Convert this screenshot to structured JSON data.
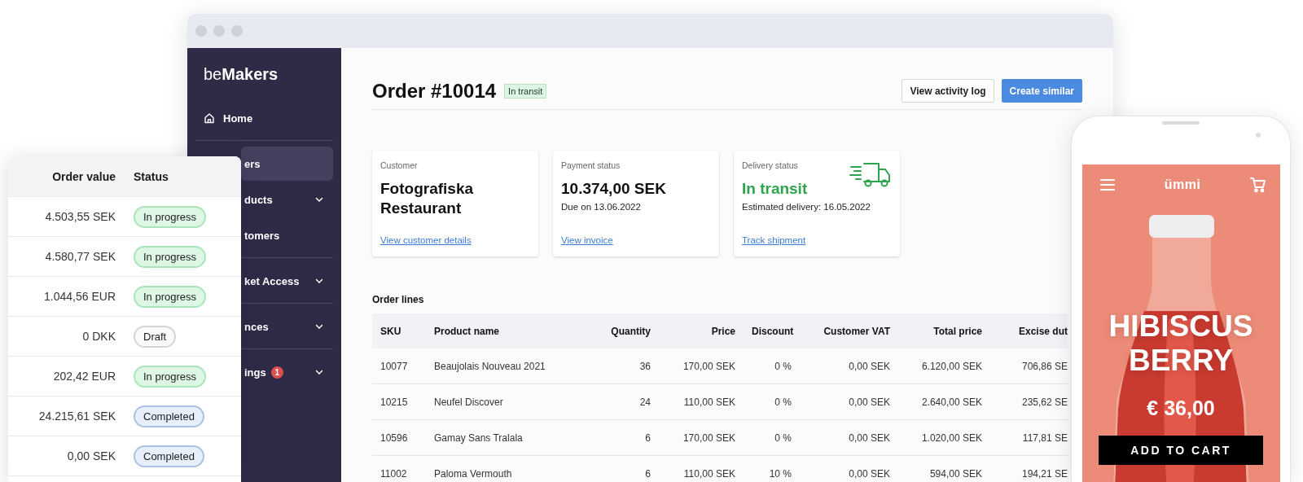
{
  "browser": {
    "sidebar": {
      "logo": "be**Makers**",
      "items": [
        {
          "label": "Home",
          "kind": "with_icon",
          "selected": false,
          "expandable": false,
          "divider": true
        },
        {
          "label": "ers",
          "kind": "plain",
          "selected": true,
          "expandable": false,
          "divider": false
        },
        {
          "label": "ducts",
          "kind": "plain",
          "selected": false,
          "expandable": true,
          "divider": false
        },
        {
          "label": "tomers",
          "kind": "plain",
          "selected": false,
          "expandable": false,
          "divider": true
        },
        {
          "label": "ket Access",
          "kind": "plain",
          "selected": false,
          "expandable": true,
          "divider": true
        },
        {
          "label": "nces",
          "kind": "plain",
          "selected": false,
          "expandable": true,
          "divider": true
        },
        {
          "label": "ings",
          "kind": "plain",
          "selected": false,
          "expandable": true,
          "divider": false,
          "badge": "1"
        }
      ]
    },
    "main": {
      "title": "Order #10014",
      "status": "In transit",
      "actions": [
        {
          "label": "View activity log",
          "kind": "secondary"
        },
        {
          "label": "Create similar",
          "kind": "primary"
        }
      ],
      "cards": [
        {
          "kind": "plain",
          "label": "Customer",
          "value": "Fotografiska Restaurant",
          "link": "View customer details"
        },
        {
          "kind": "plain",
          "label": "Payment status",
          "value": "10.374,00 SEK",
          "note": "Due on 13.06.2022",
          "link": "View invoice"
        },
        {
          "kind": "delivery",
          "label": "Delivery status",
          "value": "In transit",
          "note": "Estimated delivery: 16.05.2022",
          "link": "Track shipment"
        }
      ],
      "order_lines": {
        "title": "Order lines",
        "columns": [
          "SKU",
          "Product name",
          "Quantity",
          "Price",
          "Discount",
          "Customer VAT",
          "Total price",
          "Excise dut"
        ],
        "rows": [
          [
            "10077",
            "Beaujolais Nouveau 2021",
            "36",
            "170,00 SEK",
            "0 %",
            "0,00 SEK",
            "6.120,00 SEK",
            "706,86 SE"
          ],
          [
            "10215",
            "Neufel Discover",
            "24",
            "110,00 SEK",
            "0 %",
            "0,00 SEK",
            "2.640,00 SEK",
            "235,62 SE"
          ],
          [
            "10596",
            "Gamay Sans Tralala",
            "6",
            "170,00 SEK",
            "0 %",
            "0,00 SEK",
            "1.020,00 SEK",
            "117,81 SE"
          ],
          [
            "11002",
            "Paloma Vermouth",
            "6",
            "110,00 SEK",
            "10 %",
            "0,00 SEK",
            "594,00 SEK",
            "194,21 SE"
          ]
        ]
      }
    }
  },
  "orders_panel": {
    "columns": [
      "Order value",
      "Status"
    ],
    "rows": [
      {
        "value": "4.503,55 SEK",
        "status": "In progress",
        "kind": "progress"
      },
      {
        "value": "4.580,77 SEK",
        "status": "In progress",
        "kind": "progress"
      },
      {
        "value": "1.044,56 EUR",
        "status": "In progress",
        "kind": "progress"
      },
      {
        "value": "0 DKK",
        "status": "Draft",
        "kind": "draft"
      },
      {
        "value": "202,42 EUR",
        "status": "In progress",
        "kind": "progress"
      },
      {
        "value": "24.215,61 SEK",
        "status": "Completed",
        "kind": "completed"
      },
      {
        "value": "0,00 SEK",
        "status": "Completed",
        "kind": "completed"
      }
    ]
  },
  "phone": {
    "logo": "ümmi",
    "title": "HIBISCUS BERRY",
    "price": "€ 36,00",
    "button": "ADD TO CART"
  }
}
